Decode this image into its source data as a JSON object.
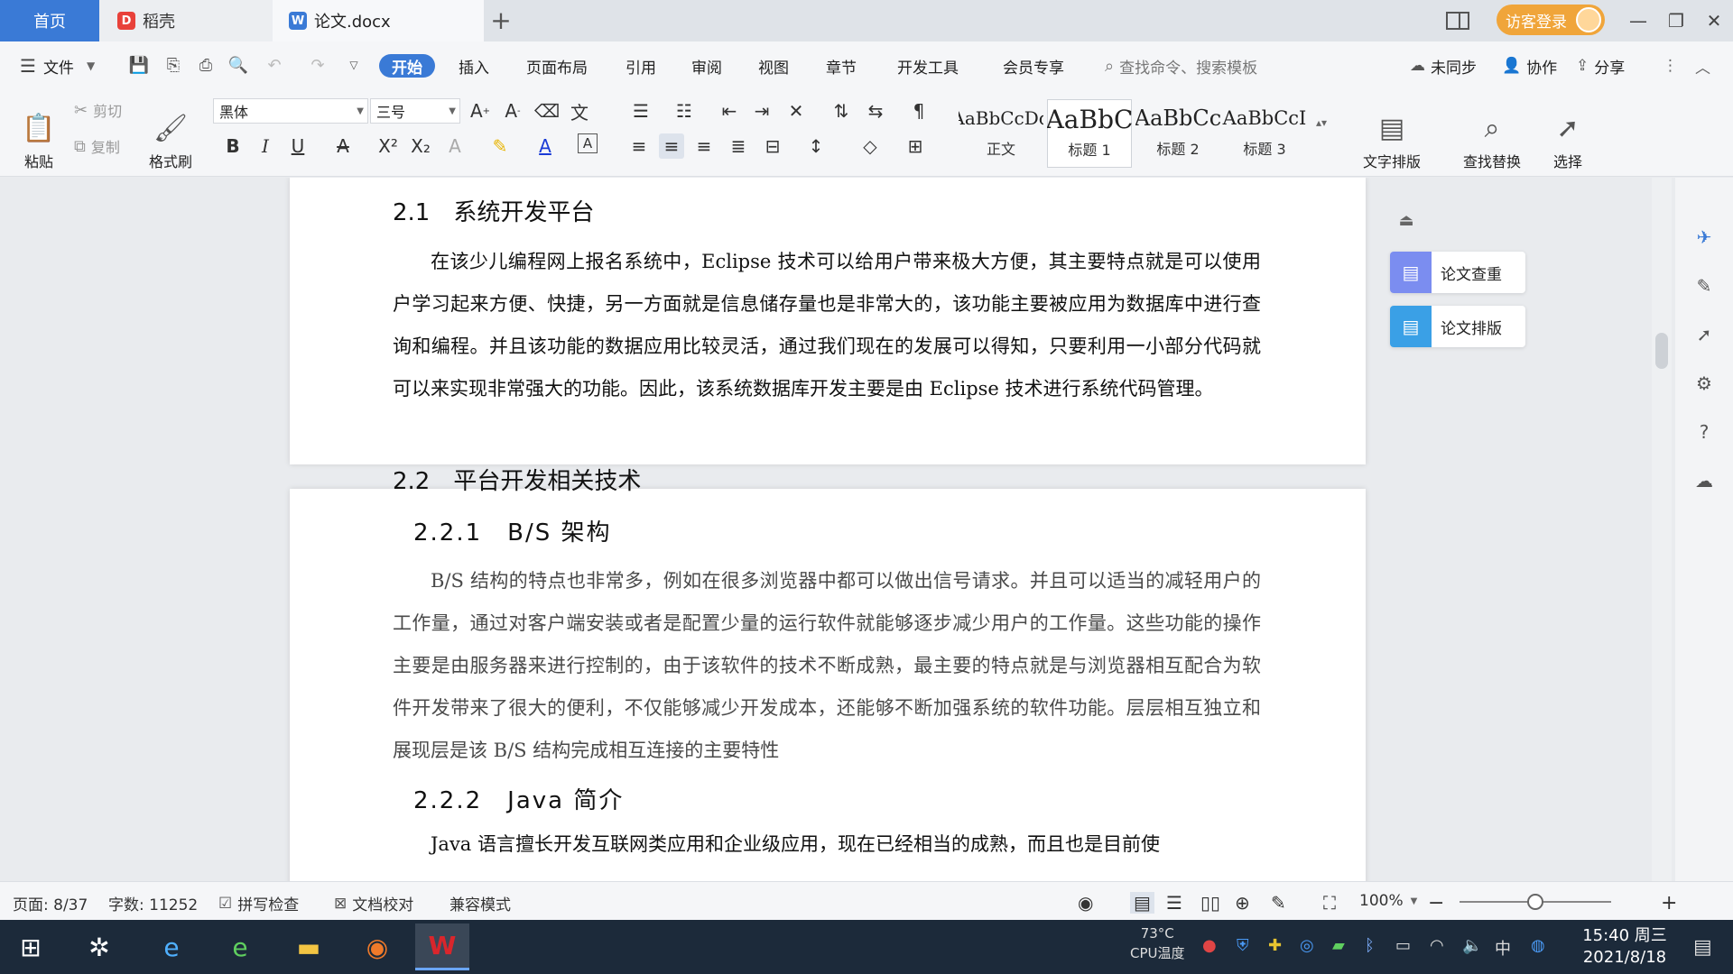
{
  "tabs": {
    "home": "首页",
    "daoke": "稻壳",
    "doc": "论文.docx"
  },
  "titlebar": {
    "login": "访客登录"
  },
  "menu": {
    "file": "文件",
    "items": [
      "开始",
      "插入",
      "页面布局",
      "引用",
      "审阅",
      "视图",
      "章节",
      "开发工具",
      "会员专享"
    ],
    "search_placeholder": "查找命令、搜索模板",
    "sync": "未同步",
    "collab": "协作",
    "share": "分享"
  },
  "ribbon": {
    "paste": "粘贴",
    "cut": "剪切",
    "copy": "复制",
    "format_painter": "格式刷",
    "font_name": "黑体",
    "font_size": "三号",
    "styles": [
      {
        "sample": "AaBbCcDd",
        "label": "正文"
      },
      {
        "sample": "AaBbC",
        "label": "标题 1"
      },
      {
        "sample": "AaBbCc",
        "label": "标题 2"
      },
      {
        "sample": "AaBbCcI",
        "label": "标题 3"
      }
    ],
    "text_layout": "文字排版",
    "find_replace": "查找替换",
    "select": "选择"
  },
  "document": {
    "sec_2_1": "2.1　系统开发平台",
    "para_2_1": "在该少儿编程网上报名系统中，Eclipse 技术可以给用户带来极大方便，其主要特点就是可以使用户学习起来方便、快捷，另一方面就是信息储存量也是非常大的，该功能主要被应用为数据库中进行查询和编程。并且该功能的数据应用比较灵活，通过我们现在的发展可以得知，只要利用一小部分代码就可以来实现非常强大的功能。因此，该系统数据库开发主要是由 Eclipse 技术进行系统代码管理。",
    "sec_2_2": "2.2　平台开发相关技术",
    "sec_2_2_1": "2.2.1　B/S 架构",
    "para_2_2_1": "B/S 结构的特点也非常多，例如在很多浏览器中都可以做出信号请求。并且可以适当的减轻用户的工作量，通过对客户端安装或者是配置少量的运行软件就能够逐步减少用户的工作量。这些功能的操作主要是由服务器来进行控制的，由于该软件的技术不断成熟，最主要的特点就是与浏览器相互配合为软件开发带来了很大的便利，不仅能够减少开发成本，还能够不断加强系统的软件功能。层层相互独立和展现层是该 B/S 结构完成相互连接的主要特性",
    "sec_2_2_2": "2.2.2　Java 简介",
    "para_2_2_2": "Java 语言擅长开发互联网类应用和企业级应用，现在已经相当的成熟，而且也是目前使"
  },
  "side_panel": {
    "check": "论文查重",
    "layout": "论文排版"
  },
  "status": {
    "page": "页面: 8/37",
    "words": "字数: 11252",
    "spell": "拼写检查",
    "proof": "文档校对",
    "compat": "兼容模式",
    "zoom": "100%",
    "zoom_level": 0.5
  },
  "taskbar": {
    "temp": "73°C",
    "temp_label": "CPU温度",
    "ime": "中",
    "time": "15:40 周三",
    "date": "2021/8/18"
  },
  "colors": {
    "accent": "#3a7ad6",
    "login": "#f0a53a",
    "check_icon": "#7b8df0",
    "layout_icon": "#3aa0e6",
    "wps_red": "#d9262c"
  }
}
